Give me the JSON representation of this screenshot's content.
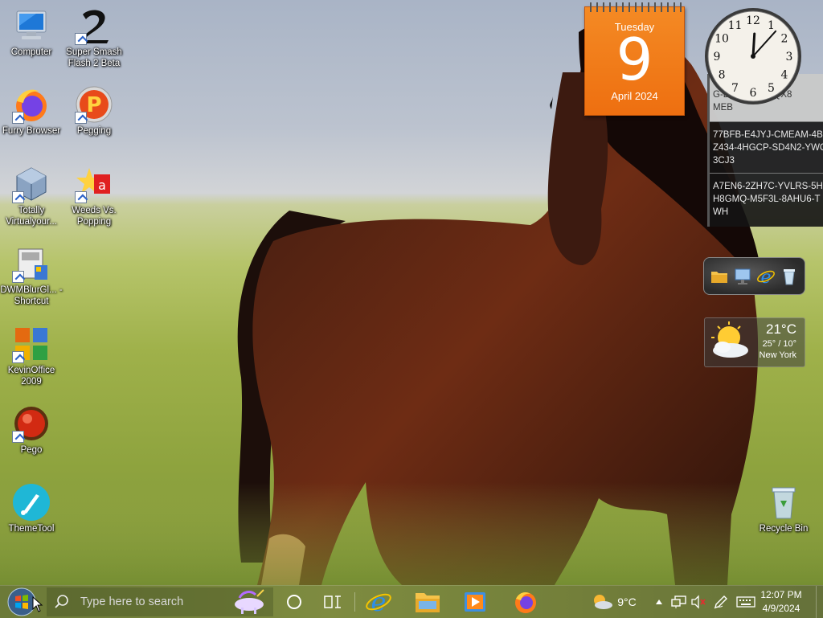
{
  "desktop": {
    "icons": [
      {
        "label": "Computer",
        "icon": "computer-icon"
      },
      {
        "label": "Super Smash Flash 2 Beta",
        "icon": "ssf2-icon"
      },
      {
        "label": "Furry Browser",
        "icon": "firefox-icon"
      },
      {
        "label": "Pegging",
        "icon": "pegging-icon"
      },
      {
        "label": "Totally Virtualyour...",
        "icon": "virtual-box-icon"
      },
      {
        "label": "Weeds Vs. Popping",
        "icon": "weeds-icon"
      },
      {
        "label": "DWMBlurGl... - Shortcut",
        "icon": "dwm-blur-icon"
      },
      {
        "label": "KevinOffice 2009",
        "icon": "office-icon"
      },
      {
        "label": "Pego",
        "icon": "pego-icon"
      },
      {
        "label": "ThemeTool",
        "icon": "theme-tool-icon"
      },
      {
        "label": "Recycle Bin",
        "icon": "recycle-bin-icon"
      }
    ]
  },
  "calendar_gadget": {
    "weekday": "Tuesday",
    "day": "9",
    "month_year": "April 2024"
  },
  "clock_gadget": {
    "hours": 12,
    "minutes": 7,
    "numerals": [
      "12",
      "1",
      "2",
      "3",
      "4",
      "5",
      "6",
      "7",
      "8",
      "9",
      "10",
      "11"
    ]
  },
  "notes_gadget": {
    "notes": [
      "L...WY7-R\nG-D7...SQ-DMQX8\nMEB",
      "77BFB-E4JYJ-CMEAM-4B4\nZ434-4HGCP-SD4N2-YWC\n3CJ3",
      "A7EN6-2ZH7C-YVLRS-5H\nH8GMQ-M5F3L-8AHU6-T\nWH"
    ]
  },
  "weather_gadget": {
    "temp": "21°C",
    "range": "25° / 10°",
    "city": "New York"
  },
  "taskbar": {
    "search_placeholder": "Type here to search",
    "weather_temp": "9°C",
    "clock_time": "12:07 PM",
    "clock_date": "4/9/2024",
    "colors": {
      "accent": "#7e8b40"
    }
  }
}
